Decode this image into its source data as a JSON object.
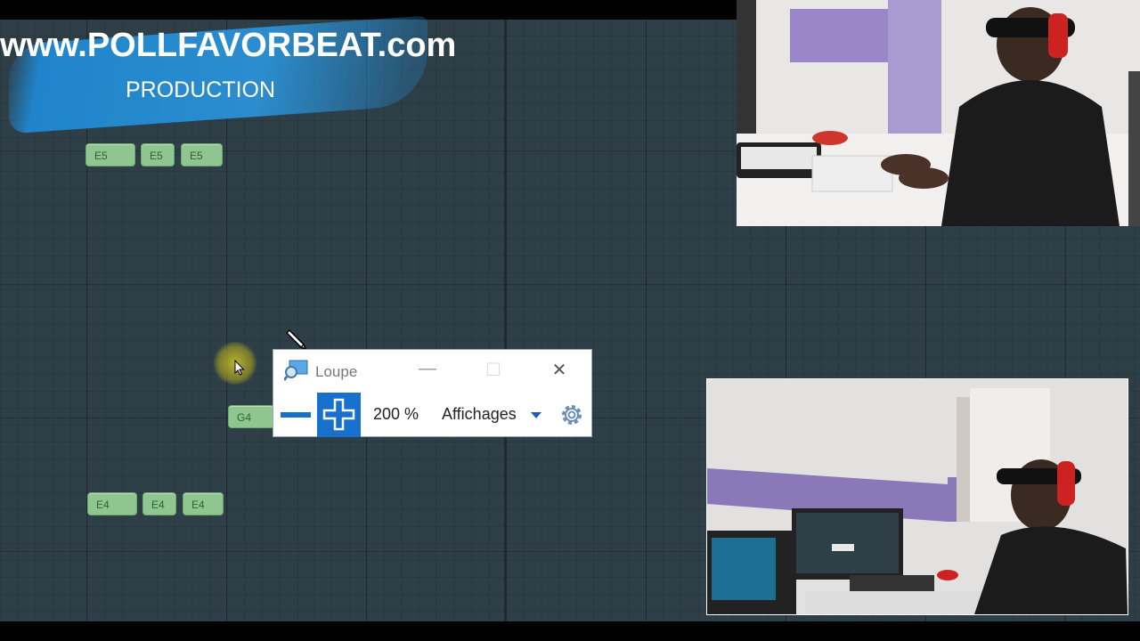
{
  "brand": {
    "url": "www.POLLFAVORBEAT.com",
    "subtitle": "PRODUCTION"
  },
  "piano_roll": {
    "notes": [
      {
        "label": "E5"
      },
      {
        "label": "E5"
      },
      {
        "label": "E5"
      },
      {
        "label": "G4"
      },
      {
        "label": "E4"
      },
      {
        "label": "E4"
      },
      {
        "label": "E4"
      }
    ]
  },
  "loupe": {
    "title": "Loupe",
    "minimize_glyph": "—",
    "maximize_glyph": "☐",
    "close_glyph": "✕",
    "zoom_level": "200 %",
    "views_label": "Affichages",
    "icons": {
      "app": "magnifier-icon",
      "zoom_out": "minus-icon",
      "zoom_in": "plus-icon",
      "views": "caret-down-icon",
      "settings": "gear-icon"
    },
    "accent": "#1670cc"
  },
  "colors": {
    "grid_bg": "#2f3f47",
    "note_fill": "#8fc58f",
    "brush_blue": "#1e88d2"
  }
}
